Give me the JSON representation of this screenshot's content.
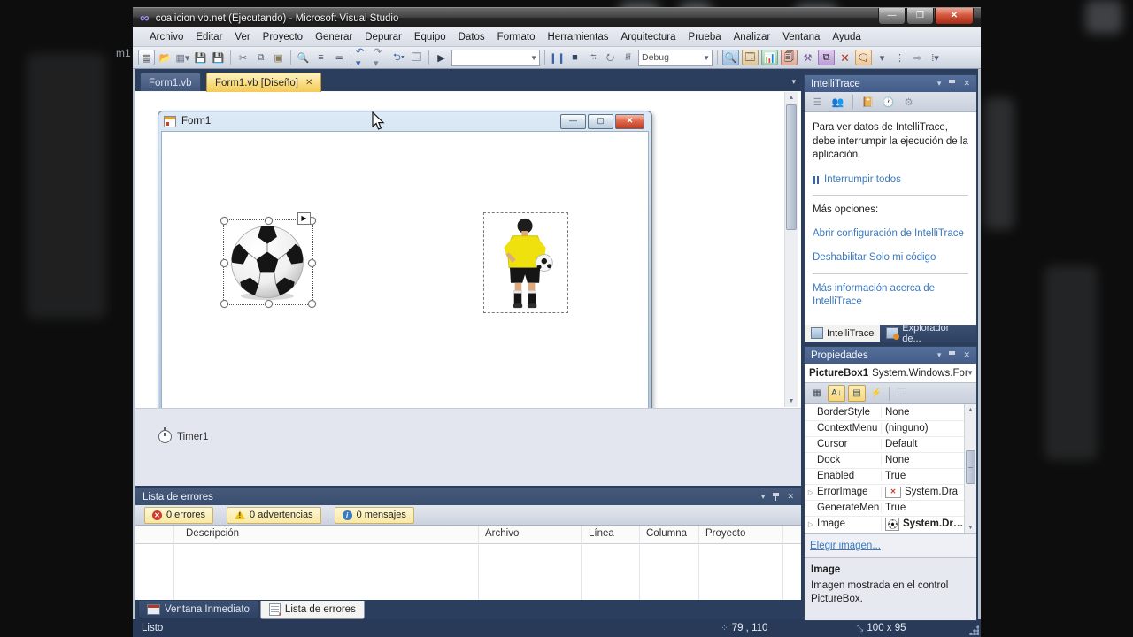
{
  "window": {
    "title": "coalicion vb.net (Ejecutando) - Microsoft Visual Studio",
    "bg_fragment": "m1"
  },
  "menu": {
    "items": [
      "Archivo",
      "Editar",
      "Ver",
      "Proyecto",
      "Generar",
      "Depurar",
      "Equipo",
      "Datos",
      "Formato",
      "Herramientas",
      "Arquitectura",
      "Prueba",
      "Analizar",
      "Ventana",
      "Ayuda"
    ]
  },
  "toolbar": {
    "debug_label": "Debug"
  },
  "doc_tabs": [
    {
      "label": "Form1.vb"
    },
    {
      "label": "Form1.vb [Diseño]"
    }
  ],
  "designer": {
    "form_title": "Form1",
    "tray_item": "Timer1"
  },
  "intellitrace": {
    "title": "IntelliTrace",
    "message": "Para ver datos de IntelliTrace, debe interrumpir la ejecución de la aplicación.",
    "break_all": "Interrumpir todos",
    "more_options": "Más opciones:",
    "links": [
      "Abrir configuración de IntelliTrace",
      "Deshabilitar Solo mi código",
      "Más información acerca de IntelliTrace"
    ],
    "tabs": [
      "IntelliTrace",
      "Explorador de..."
    ]
  },
  "properties": {
    "title": "Propiedades",
    "object_name": "PictureBox1",
    "object_type": "System.Windows.For",
    "rows": [
      {
        "name": "BorderStyle",
        "value": "None"
      },
      {
        "name": "ContextMenu",
        "value": "(ninguno)"
      },
      {
        "name": "Cursor",
        "value": "Default"
      },
      {
        "name": "Dock",
        "value": "None"
      },
      {
        "name": "Enabled",
        "value": "True"
      },
      {
        "name": "ErrorImage",
        "value": "System.Dra"
      },
      {
        "name": "GenerateMen",
        "value": "True"
      },
      {
        "name": "Image",
        "value": "System.Dr…"
      }
    ],
    "choose_image": "Elegir imagen...",
    "desc_title": "Image",
    "desc_text": "Imagen mostrada en el control PictureBox."
  },
  "error_list": {
    "title": "Lista de errores",
    "filters": [
      "0 errores",
      "0 advertencias",
      "0 mensajes"
    ],
    "columns": [
      "Descripción",
      "Archivo",
      "Línea",
      "Columna",
      "Proyecto"
    ]
  },
  "bottom_tabs": [
    "Ventana Inmediato",
    "Lista de errores"
  ],
  "status": {
    "ready": "Listo",
    "position": "79 , 110",
    "size": "100 x 95"
  }
}
